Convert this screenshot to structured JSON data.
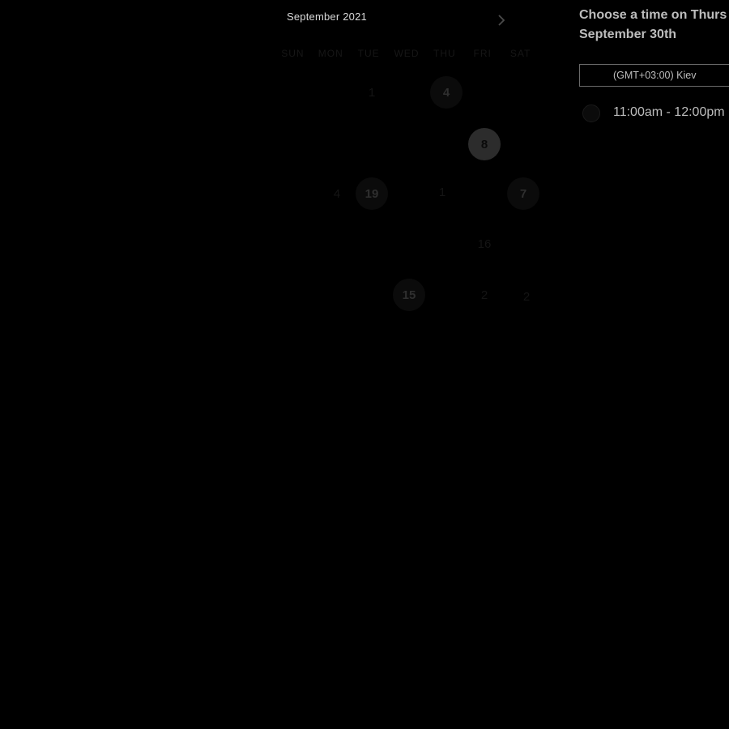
{
  "calendar": {
    "month_label": "September 2021",
    "next_icon": "chevron-right-icon",
    "weekdays": [
      "SUN",
      "MON",
      "TUE",
      "WED",
      "THU",
      "FRI",
      "SAT"
    ],
    "days": [
      {
        "label": "1",
        "state": "faint"
      },
      {
        "label": "4",
        "state": "available"
      },
      {
        "label": "8",
        "state": "selected"
      },
      {
        "label": "4",
        "state": "faint"
      },
      {
        "label": "19",
        "state": "available"
      },
      {
        "label": "1",
        "state": "faint"
      },
      {
        "label": "7",
        "state": "available"
      },
      {
        "label": "16",
        "state": "faint"
      },
      {
        "label": "15",
        "state": "available"
      },
      {
        "label": "2",
        "state": "faint"
      },
      {
        "label": "2",
        "state": "faint"
      }
    ]
  },
  "time_panel": {
    "heading_line1": "Choose a time on Thurs",
    "heading_line2": "September 30th",
    "timezone": "(GMT+03:00) Kiev",
    "slots": [
      {
        "label": "11:00am - 12:00pm"
      }
    ]
  },
  "colors": {
    "background": "#000000",
    "text": "#bdbdbd",
    "selected_day_bg": "#2c2c2c",
    "border": "#6a6a6a"
  }
}
